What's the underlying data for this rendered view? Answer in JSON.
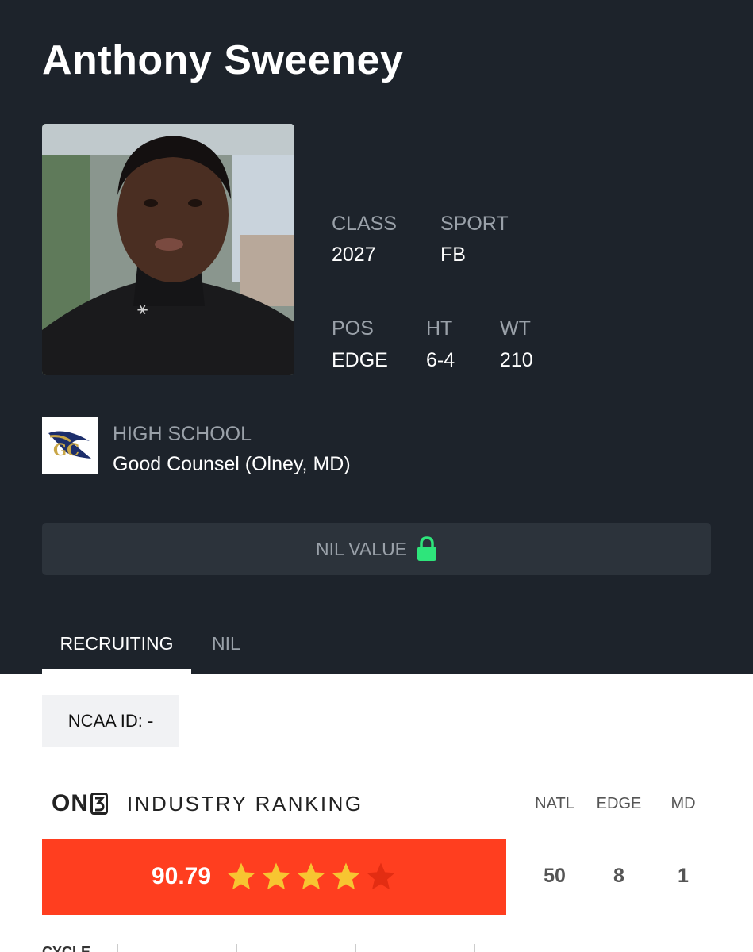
{
  "player": {
    "name": "Anthony Sweeney"
  },
  "stats": {
    "class_label": "CLASS",
    "class_value": "2027",
    "sport_label": "SPORT",
    "sport_value": "FB",
    "pos_label": "POS",
    "pos_value": "EDGE",
    "ht_label": "HT",
    "ht_value": "6-4",
    "wt_label": "WT",
    "wt_value": "210"
  },
  "school": {
    "label": "HIGH SCHOOL",
    "name": "Good Counsel (Olney, MD)",
    "logo_text": "GC"
  },
  "nil": {
    "label": "NIL VALUE",
    "icon": "lock-icon",
    "icon_color": "#2ee57b"
  },
  "tabs": [
    {
      "label": "RECRUITING",
      "active": true
    },
    {
      "label": "NIL",
      "active": false
    }
  ],
  "ncaa": {
    "text": "NCAA ID:  -"
  },
  "ranking": {
    "brand": "ON",
    "title": "INDUSTRY RANKING",
    "score": "90.79",
    "stars": 4,
    "max_stars": 5,
    "bar_color": "#ff3e1f",
    "star_color": "#f7c531",
    "columns": [
      {
        "label": "NATL",
        "value": "50"
      },
      {
        "label": "EDGE",
        "value": "8"
      },
      {
        "label": "MD",
        "value": "1"
      }
    ]
  },
  "cycle": {
    "label": "CYCLE"
  }
}
